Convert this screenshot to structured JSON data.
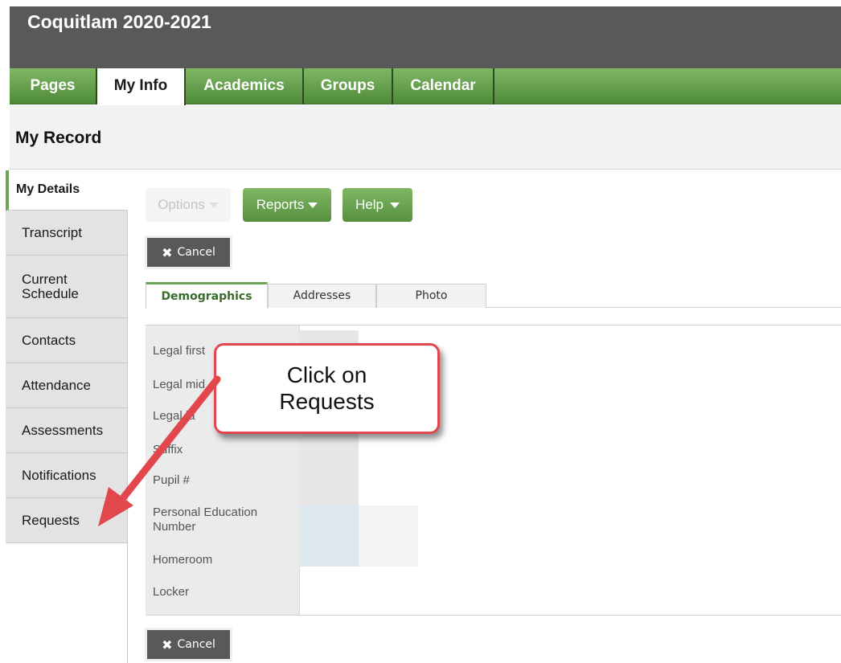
{
  "app": {
    "title": "Coquitlam 2020-2021"
  },
  "topnav": {
    "tabs": [
      "Pages",
      "My Info",
      "Academics",
      "Groups",
      "Calendar"
    ],
    "active": "My Info"
  },
  "page": {
    "title": "My Record"
  },
  "sidenav": {
    "items": [
      "My Details",
      "Transcript",
      "Current Schedule",
      "Contacts",
      "Attendance",
      "Assessments",
      "Notifications",
      "Requests"
    ],
    "active": "My Details"
  },
  "toolbar": {
    "options": "Options",
    "reports": "Reports",
    "help": "Help",
    "cancel": "Cancel"
  },
  "subtabs": {
    "items": [
      "Demographics",
      "Addresses",
      "Photo"
    ],
    "active": "Demographics"
  },
  "form": {
    "labels": [
      "Legal first",
      "Legal mid",
      "Legal la",
      "Suffix",
      "Pupil #",
      "Personal Education Number",
      "Homeroom",
      "Locker"
    ]
  },
  "callout": {
    "text": "Click on Requests"
  },
  "colors": {
    "accent_green": "#6ca555",
    "header_gray": "#595959",
    "callout_red": "#e2474d"
  }
}
